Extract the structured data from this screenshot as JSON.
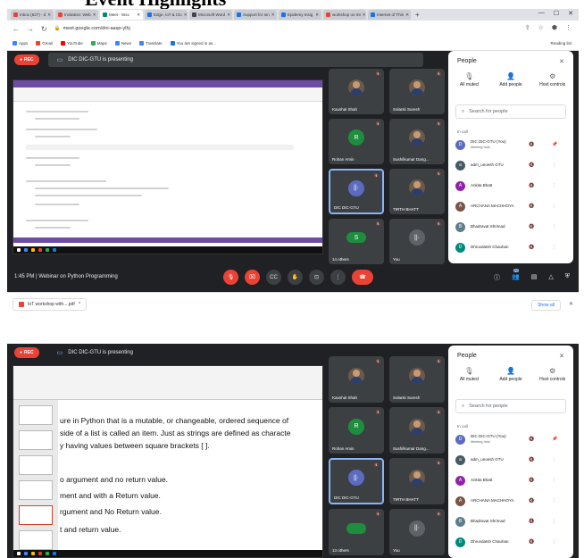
{
  "heading_text": "Event Highlights",
  "browser": {
    "tabs": [
      {
        "label": "Inbox (627) - d",
        "color": "#ea4335"
      },
      {
        "label": "Invitation: Web",
        "color": "#ea4335"
      },
      {
        "label": "Meet - Wxx",
        "color": "#00897b",
        "active": true
      },
      {
        "label": "Edge, IoT & Clo",
        "color": "#1a73e8"
      },
      {
        "label": "Microsoft Word",
        "color": "#444"
      },
      {
        "label": "Support for Inn",
        "color": "#1a73e8"
      },
      {
        "label": "Epidemy Insig",
        "color": "#1a73e8"
      },
      {
        "label": "workshop on Int",
        "color": "#ea4335"
      },
      {
        "label": "Internet of Thin",
        "color": "#1a73e8"
      }
    ],
    "url": "meet.google.com/dni-aaqo-ylhj",
    "bookmarks": [
      {
        "label": "Apps",
        "color": "#4285f4"
      },
      {
        "label": "Gmail",
        "color": "#ea4335"
      },
      {
        "label": "YouTube",
        "color": "#ff0000"
      },
      {
        "label": "Maps",
        "color": "#34a853"
      },
      {
        "label": "News",
        "color": "#4285f4"
      },
      {
        "label": "Translate",
        "color": "#4285f4"
      },
      {
        "label": "You are signed in as...",
        "color": "#1a73e8"
      }
    ],
    "reading_list": "Reading list"
  },
  "meet1": {
    "rec": "REC",
    "presenting": "DIC DIC-GTU is presenting",
    "time_title": "1:45 PM  |  Webinar on Python Programming",
    "tiles": [
      {
        "name": "Kaushal Shah",
        "kind": "photo"
      },
      {
        "name": "Solanki Suresh",
        "kind": "photo"
      },
      {
        "name": "Rohan Amin",
        "kind": "letter",
        "letter": "R",
        "color": "#1e8e3e"
      },
      {
        "name": "Sushilkumar Dang...",
        "kind": "photo"
      },
      {
        "name": "DIC DIC-GTU",
        "kind": "letter",
        "letter": "||·",
        "color": "#5c6bc0",
        "active": true
      },
      {
        "name": "TIRTH BHATT",
        "kind": "photo"
      },
      {
        "name": "14 others",
        "kind": "others",
        "letter": "S"
      },
      {
        "name": "You",
        "kind": "letter",
        "letter": "||·",
        "color": "#5f6368"
      }
    ]
  },
  "meet2": {
    "rec": "REC",
    "presenting": "DIC DIC-GTU is presenting",
    "tiles": [
      {
        "name": "Kaushal Shah",
        "kind": "photo"
      },
      {
        "name": "Solanki Suresh",
        "kind": "photo"
      },
      {
        "name": "Rohan Amin",
        "kind": "letter",
        "letter": "R",
        "color": "#1e8e3e"
      },
      {
        "name": "Sushilkumar Dang...",
        "kind": "photo"
      },
      {
        "name": "DIC DIC-GTU",
        "kind": "letter",
        "letter": "||·",
        "color": "#5c6bc0",
        "active": true
      },
      {
        "name": "TIRTH BHATT",
        "kind": "photo"
      },
      {
        "name": "13 others",
        "kind": "others",
        "letter": ""
      },
      {
        "name": "You",
        "kind": "letter",
        "letter": "||·",
        "color": "#5f6368"
      }
    ],
    "slide_lines": [
      "ure in Python that is a mutable, or changeable, ordered sequence of",
      "side of a list is called an item. Just as strings are defined as characte",
      "y having values between square brackets [ ].",
      "o argument and no return value.",
      "ment and with a Return value.",
      "rgument and No Return value.",
      "t and return value."
    ]
  },
  "people": {
    "title": "People",
    "actions": [
      {
        "label": "All muted",
        "icon": "mic-off-icon",
        "glyph": "🎙"
      },
      {
        "label": "Add people",
        "icon": "add-person-icon",
        "glyph": "👤"
      },
      {
        "label": "Host controls",
        "icon": "host-controls-icon",
        "glyph": "⚙"
      }
    ],
    "search_placeholder": "Search for people",
    "in_call": "In call",
    "participants": [
      {
        "name": "DIC DIC-GTU (You)",
        "sub": "Meeting host",
        "color": "#5c6bc0",
        "letter": "D"
      },
      {
        "name": "adm_unoesh GTU",
        "sub": "",
        "color": "#455a64",
        "letter": "a"
      },
      {
        "name": "Ankita Bhatt",
        "sub": "",
        "color": "#8e24aa",
        "letter": "A"
      },
      {
        "name": "ARCHANA MACHHOYA",
        "sub": "",
        "color": "#795548",
        "letter": "A"
      },
      {
        "name": "Bhadravat Shrimad",
        "sub": "",
        "color": "#607d8b",
        "letter": "B"
      },
      {
        "name": "Dhruvdatsh Chauhan",
        "sub": "",
        "color": "#00897b",
        "letter": "D"
      }
    ]
  },
  "download": {
    "file": "IoT workshop with....pdf",
    "show_all": "Show all"
  },
  "participant_badge": "22"
}
